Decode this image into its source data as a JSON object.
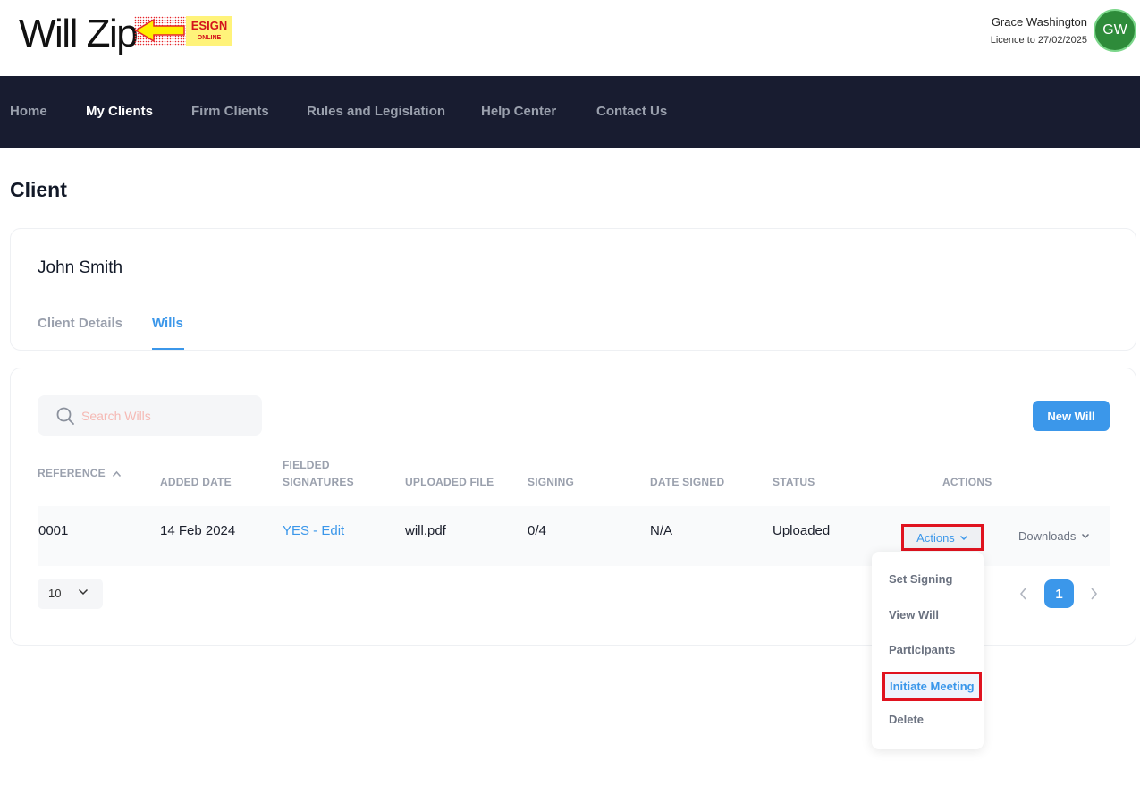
{
  "header": {
    "logo_text": "Will Zip",
    "badge_text": "ESIGN",
    "badge_subtext": "ONLINE",
    "user_name": "Grace Washington",
    "licence": "Licence to 27/02/2025",
    "avatar_initials": "GW",
    "avatar_color": "#2e8b3a"
  },
  "nav": {
    "items": [
      {
        "label": "Home"
      },
      {
        "label": "My Clients"
      },
      {
        "label": "Firm Clients"
      },
      {
        "label": "Rules and Legislation"
      },
      {
        "label": "Help Center"
      },
      {
        "label": "Contact Us"
      }
    ],
    "active": "My Clients"
  },
  "page": {
    "title": "Client"
  },
  "client": {
    "name": "John Smith",
    "tabs": [
      {
        "label": "Client Details"
      },
      {
        "label": "Wills"
      }
    ],
    "active_tab": "Wills"
  },
  "wills": {
    "search_placeholder": "Search Wills",
    "new_will_label": "New Will",
    "columns": {
      "reference": "REFERENCE",
      "added_date": "ADDED DATE",
      "fielded_line1": "FIELDED",
      "fielded_line2": "SIGNATURES",
      "uploaded_file": "UPLOADED FILE",
      "signing": "SIGNING",
      "date_signed": "DATE SIGNED",
      "status": "STATUS",
      "actions": "ACTIONS"
    },
    "rows": [
      {
        "reference": "0001",
        "added_date": "14 Feb 2024",
        "fielded_signatures": "YES - Edit",
        "uploaded_file": "will.pdf",
        "signing": "0/4",
        "date_signed": "N/A",
        "status": "Uploaded",
        "actions_label": "Actions",
        "downloads_label": "Downloads"
      }
    ],
    "page_size": "10",
    "current_page": "1"
  },
  "actions_menu": {
    "items": [
      {
        "label": "Set Signing"
      },
      {
        "label": "View Will"
      },
      {
        "label": "Participants"
      },
      {
        "label": "Initiate Meeting"
      },
      {
        "label": "Delete"
      }
    ],
    "highlighted": "Initiate Meeting"
  },
  "colors": {
    "primary": "#3b97ea",
    "nav_bg": "#181c30",
    "highlight_border": "#e0131f"
  }
}
